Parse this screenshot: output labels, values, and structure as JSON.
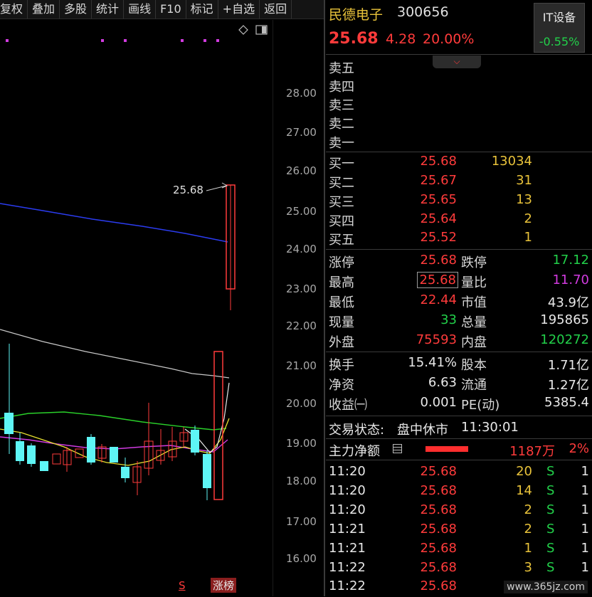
{
  "toolbar": {
    "items": [
      "复权",
      "叠加",
      "多股",
      "统计",
      "画线",
      "F10",
      "标记",
      "+自选",
      "返回"
    ]
  },
  "chart": {
    "price_ticks": [
      "28.00",
      "27.00",
      "26.00",
      "25.00",
      "24.00",
      "23.00",
      "22.00",
      "21.00",
      "20.00",
      "19.00",
      "18.00",
      "17.00",
      "16.00"
    ],
    "last_label": "25.68",
    "s_label": "S",
    "rank_badge": "涨榜",
    "colors": {
      "up": "#ff3b3b",
      "down": "#5ef5f5",
      "ma_blue": "#2b3cf0",
      "ma_gray": "#c8c8c8",
      "ma_green": "#2ad02a",
      "ma_yellow": "#e8e030",
      "ma_magenta": "#d03be0"
    }
  },
  "quote": {
    "name": "民德电子",
    "code": "300656",
    "price": "25.68",
    "change": "4.28",
    "change_pct": "20.00%",
    "sector_name": "IT设备",
    "sector_pct": "-0.55%"
  },
  "order_book": {
    "asks": [
      {
        "label": "卖五",
        "price": "",
        "vol": ""
      },
      {
        "label": "卖四",
        "price": "",
        "vol": ""
      },
      {
        "label": "卖三",
        "price": "",
        "vol": ""
      },
      {
        "label": "卖二",
        "price": "",
        "vol": ""
      },
      {
        "label": "卖一",
        "price": "",
        "vol": ""
      }
    ],
    "bids": [
      {
        "label": "买一",
        "price": "25.68",
        "vol": "13034"
      },
      {
        "label": "买二",
        "price": "25.67",
        "vol": "31"
      },
      {
        "label": "买三",
        "price": "25.65",
        "vol": "13"
      },
      {
        "label": "买四",
        "price": "25.64",
        "vol": "2"
      },
      {
        "label": "买五",
        "price": "25.52",
        "vol": "1"
      }
    ]
  },
  "stats": {
    "limit_up_label": "涨停",
    "limit_up": "25.68",
    "limit_down_label": "跌停",
    "limit_down": "17.12",
    "high_label": "最高",
    "high": "25.68",
    "vol_ratio_label": "量比",
    "vol_ratio": "11.70",
    "low_label": "最低",
    "low": "22.44",
    "mkt_cap_label": "市值",
    "mkt_cap": "43.9亿",
    "cur_vol_label": "现量",
    "cur_vol": "33",
    "total_vol_label": "总量",
    "total_vol": "195865",
    "outer_label": "外盘",
    "outer": "75593",
    "inner_label": "内盘",
    "inner": "120272",
    "turnover_label": "换手",
    "turnover": "15.41%",
    "capital_label": "股本",
    "capital": "1.71亿",
    "net_asset_label": "净资",
    "net_asset": "6.63",
    "float_label": "流通",
    "float": "1.27亿",
    "eps_label": "收益㈠",
    "eps": "0.001",
    "pe_label": "PE(动)",
    "pe": "5385.4"
  },
  "status": {
    "label": "交易状态:",
    "state": "盘中休市",
    "time": "11:30:01"
  },
  "fund_flow": {
    "label": "主力净额",
    "amount": "1187万",
    "pct": "2%"
  },
  "ticks": [
    {
      "time": "11:20",
      "price": "25.68",
      "vol": "20",
      "side": "S",
      "n": "1"
    },
    {
      "time": "11:20",
      "price": "25.68",
      "vol": "14",
      "side": "S",
      "n": "1"
    },
    {
      "time": "11:20",
      "price": "25.68",
      "vol": "2",
      "side": "S",
      "n": "1"
    },
    {
      "time": "11:21",
      "price": "25.68",
      "vol": "2",
      "side": "S",
      "n": "1"
    },
    {
      "time": "11:21",
      "price": "25.68",
      "vol": "1",
      "side": "S",
      "n": "1"
    },
    {
      "time": "11:22",
      "price": "25.68",
      "vol": "3",
      "side": "S",
      "n": "1"
    },
    {
      "time": "11:22",
      "price": "25.68",
      "vol": "",
      "side": "",
      "n": ""
    }
  ],
  "watermark": "www.365jz.com"
}
